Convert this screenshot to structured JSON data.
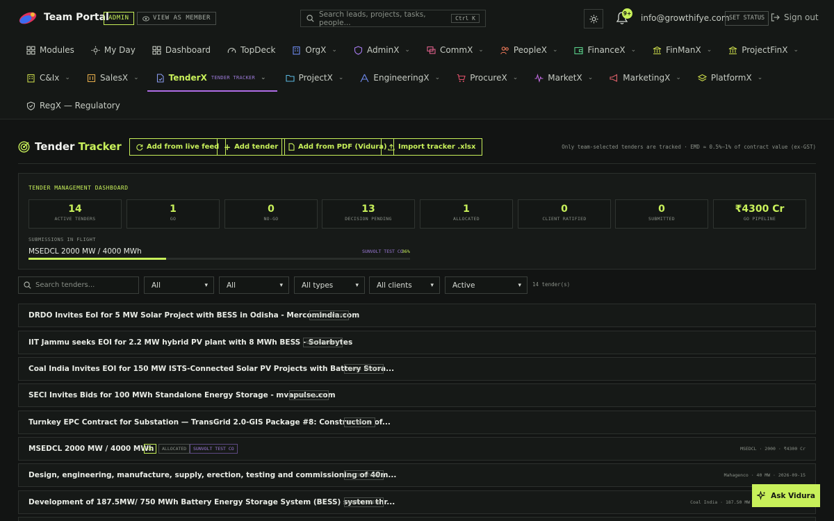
{
  "topbar": {
    "app_title": "Team Portal",
    "admin_badge": "ADMIN",
    "view_as_member": "VIEW AS MEMBER",
    "search_placeholder": "Search leads, projects, tasks, people...",
    "search_shortcut": "Ctrl K",
    "notifications_count": "9+",
    "email": "info@growthifye.com",
    "set_status": "SET STATUS",
    "sign_out": "Sign out"
  },
  "nav": {
    "row1": [
      {
        "label": "Modules",
        "icon": "grid-icon"
      },
      {
        "label": "My Day",
        "icon": "sun-icon"
      },
      {
        "label": "Dashboard",
        "icon": "dashboard-icon"
      },
      {
        "label": "TopDeck",
        "icon": "gauge-icon"
      },
      {
        "label": "OrgX",
        "icon": "building-icon",
        "dropdown": true
      },
      {
        "label": "AdminX",
        "icon": "shield-icon",
        "dropdown": true
      },
      {
        "label": "CommX",
        "icon": "chat-icon",
        "dropdown": true
      },
      {
        "label": "PeopleX",
        "icon": "people-icon",
        "dropdown": true
      },
      {
        "label": "FinanceX",
        "icon": "wallet-icon",
        "dropdown": true
      },
      {
        "label": "FinManX",
        "icon": "bank-icon",
        "dropdown": true
      },
      {
        "label": "ProjectFinX",
        "icon": "bank-icon",
        "dropdown": true
      }
    ],
    "row2": [
      {
        "label": "C&Ix",
        "icon": "building-icon",
        "dropdown": true
      },
      {
        "label": "SalesX",
        "icon": "sales-icon",
        "dropdown": true
      },
      {
        "label": "TenderX",
        "icon": "document-icon",
        "dropdown": true,
        "active": true,
        "sublabel": "TENDER TRACKER"
      },
      {
        "label": "ProjectX",
        "icon": "folder-icon",
        "dropdown": true
      },
      {
        "label": "EngineeringX",
        "icon": "engineering-icon",
        "dropdown": true
      },
      {
        "label": "ProcureX",
        "icon": "cart-icon",
        "dropdown": true
      },
      {
        "label": "MarketX",
        "icon": "pulse-icon",
        "dropdown": true
      },
      {
        "label": "MarketingX",
        "icon": "megaphone-icon",
        "dropdown": true
      },
      {
        "label": "PlatformX",
        "icon": "layers-icon",
        "dropdown": true
      }
    ],
    "row3": [
      {
        "label": "RegX — Regulatory",
        "icon": "shield-check-icon"
      }
    ]
  },
  "page": {
    "title_part1": "Tender",
    "title_part2": "Tracker",
    "buttons": {
      "live_feed": "Add from live feed",
      "add_tender": "Add tender",
      "add_pdf": "Add from PDF (Vidura)",
      "import": "Import tracker .xlsx"
    },
    "note": "Only team-selected tenders are tracked · EMD ≈ 0.5%–1% of contract value (ex-GST)"
  },
  "dashboard": {
    "title": "TENDER MANAGEMENT DASHBOARD",
    "stats": [
      {
        "value": "14",
        "label": "ACTIVE TENDERS"
      },
      {
        "value": "1",
        "label": "GO"
      },
      {
        "value": "0",
        "label": "NO-GO"
      },
      {
        "value": "13",
        "label": "DECISION PENDING"
      },
      {
        "value": "1",
        "label": "ALLOCATED"
      },
      {
        "value": "0",
        "label": "CLIENT RATIFIED"
      },
      {
        "value": "0",
        "label": "SUBMITTED"
      },
      {
        "value": "₹4300 Cr",
        "label": "GO PIPELINE"
      }
    ],
    "submissions": {
      "label": "SUBMISSIONS IN FLIGHT",
      "name": "MSEDCL 2000 MW / 4000 MWh",
      "tag": "SUNVOLT TEST CO",
      "percent_text": "36%",
      "progress": 0.36
    }
  },
  "filters": {
    "search_placeholder": "Search tenders...",
    "selects": [
      "All",
      "All",
      "All types",
      "All clients",
      "Active"
    ],
    "count": "14 tender(s)"
  },
  "tenders": [
    {
      "title": "DRDO Invites EoI for 5 MW Solar Project with BESS in Odisha - Mercomindia.com",
      "tags": [
        {
          "text": "UNDER REVIEW",
          "kind": "plain"
        }
      ],
      "meta": ""
    },
    {
      "title": "IIT Jammu seeks EOI for 2.2 MW hybrid PV plant with 8 MWh BESS - Solarbytes",
      "tags": [
        {
          "text": "UNDER REVIEW",
          "kind": "plain"
        }
      ],
      "meta": ""
    },
    {
      "title": "Coal India Invites EOI for 150 MW ISTS-Connected Solar PV Projects with Battery Stora...",
      "tags": [
        {
          "text": "UNDER REVIEW",
          "kind": "plain"
        }
      ],
      "meta": ""
    },
    {
      "title": "SECI Invites Bids for 100 MWh Standalone Energy Storage - mvapulse.com",
      "tags": [
        {
          "text": "UNDER REVIEW",
          "kind": "plain"
        }
      ],
      "meta": ""
    },
    {
      "title": "Turnkey EPC Contract for Substation — TransGrid 2.0-GIS Package #8: Construction of...",
      "tags": [
        {
          "text": "ESTIMATED",
          "kind": "plain"
        }
      ],
      "meta": ""
    },
    {
      "title": "MSEDCL 2000 MW / 4000 MWh",
      "tags": [
        {
          "text": "GO",
          "kind": "go"
        },
        {
          "text": "ALLOCATED",
          "kind": "plain"
        },
        {
          "text": "SUNVOLT TEST CO",
          "kind": "purple"
        }
      ],
      "meta": "MSEDCL · 2000 · ₹4300 Cr"
    },
    {
      "title": "Design, engineering, manufacture, supply, erection, testing and commissioning of 40m...",
      "tags": [
        {
          "text": "UNDER REVIEW",
          "kind": "plain"
        }
      ],
      "meta": "Mahagenco · 40 MW · 2026-09-15"
    },
    {
      "title": "Development of 187.5MW/ 750 MWh Battery Energy Storage System (BESS) system thr...",
      "tags": [
        {
          "text": "UNDER REVIEW",
          "kind": "plain"
        }
      ],
      "meta": "Coal India · 187.50 MW ·"
    }
  ],
  "ask_button": "Ask Vidura",
  "colors": {
    "accent": "#c8f05a",
    "purple": "#b06de8",
    "background": "#121413"
  }
}
